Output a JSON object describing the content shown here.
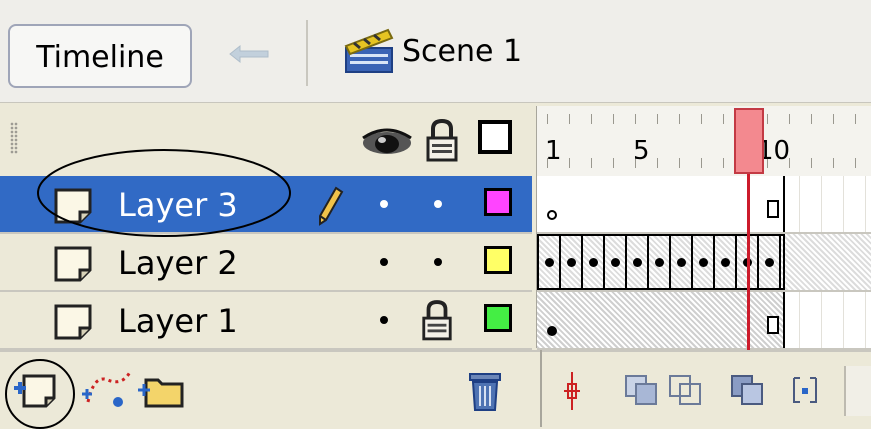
{
  "toolbar": {
    "timeline_label": "Timeline",
    "back_icon": "arrow-left-icon",
    "scene_icon": "clapperboard-icon",
    "scene_label": "Scene 1"
  },
  "layer_header": {
    "icons": [
      "eye-icon",
      "lock-icon",
      "outline-icon"
    ]
  },
  "ruler": {
    "labels": [
      "1",
      "5",
      "10"
    ],
    "current_frame": 9
  },
  "layers": [
    {
      "name": "Layer 3",
      "selected": true,
      "color": "#ff44ff",
      "editing": true,
      "visible": true,
      "locked": false,
      "frames": "keyframe-empty"
    },
    {
      "name": "Layer 2",
      "selected": false,
      "color": "#ffff66",
      "editing": false,
      "visible": true,
      "locked": false,
      "frames": "keyframes-all"
    },
    {
      "name": "Layer 1",
      "selected": false,
      "color": "#44ee44",
      "editing": false,
      "visible": true,
      "locked": true,
      "frames": "keyframe-filled"
    }
  ],
  "bottom_toolbar": {
    "icons": [
      "insert-layer-icon",
      "add-motion-guide-icon",
      "insert-folder-icon",
      "delete-layer-icon",
      "center-frame-icon",
      "onion-skin-icon",
      "onion-skin-outlines-icon",
      "edit-multiple-frames-icon",
      "modify-onion-markers-icon"
    ]
  },
  "annotations": {
    "highlight_color": "#000000"
  }
}
